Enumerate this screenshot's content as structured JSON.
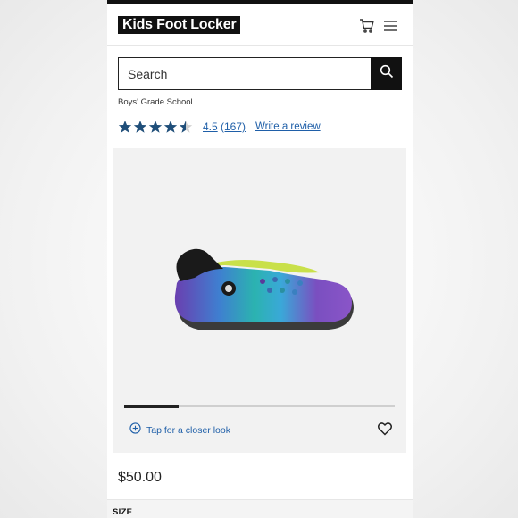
{
  "header": {
    "logo_text": "Kids Foot Locker",
    "cart_icon": "cart-icon",
    "menu_icon": "hamburger-menu-icon"
  },
  "search": {
    "placeholder": "Search",
    "button_icon": "search-icon"
  },
  "product": {
    "category": "Boys' Grade School",
    "rating": {
      "value": "4.5",
      "stars_filled": 4.5,
      "stars_total": 5,
      "count_text": "(167)",
      "write_review": "Write a review",
      "star_color": "#1f4e79"
    },
    "gallery": {
      "image_icon": "clog-shoe-image",
      "progress_fraction": 0.2,
      "closer_look": "Tap for a closer look",
      "closer_icon": "plus-circle-icon",
      "favorite_icon": "heart-icon"
    },
    "price": "$50.00",
    "size_label": "SIZE"
  },
  "colors": {
    "link": "#1f5fa8",
    "brand_black": "#111111"
  }
}
